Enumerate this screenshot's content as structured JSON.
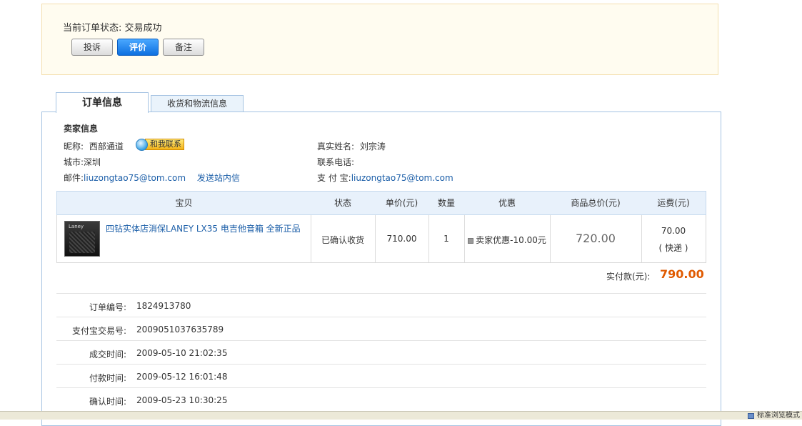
{
  "order_status": {
    "label": "当前订单状态:",
    "value": "交易成功",
    "buttons": {
      "complain": "投诉",
      "rate": "评价",
      "note": "备注"
    }
  },
  "tabs": {
    "order_info": "订单信息",
    "shipping_info": "收货和物流信息"
  },
  "seller": {
    "section_title": "卖家信息",
    "nickname_label": "昵称:",
    "nickname": "西部通道",
    "contact_me": "和我联系",
    "city_label": "城市:",
    "city": "深圳",
    "email_label": "邮件:",
    "email": "liuzongtao75@tom.com",
    "site_message": "发送站内信",
    "realname_label": "真实姓名:",
    "realname": "刘宗涛",
    "phone_label": "联系电话:",
    "phone": "",
    "alipay_label": "支 付 宝:",
    "alipay": "liuzongtao75@tom.com"
  },
  "table": {
    "headers": {
      "item": "宝贝",
      "status": "状态",
      "unit_price": "单价(元)",
      "qty": "数量",
      "discount": "优惠",
      "total": "商品总价(元)",
      "shipping": "运费(元)"
    },
    "row": {
      "title": "四钻实体店消保LANEY LX35 电吉他音箱 全新正品",
      "thumb_brand": "Laney",
      "status": "已确认收货",
      "unit_price": "710.00",
      "qty": "1",
      "discount": "卖家优惠-10.00元",
      "total": "720.00",
      "shipping": "70.00",
      "shipping_method": "( 快递 )"
    }
  },
  "paid": {
    "label": "实付款(元):",
    "amount": "790.00"
  },
  "details": {
    "order_no_label": "订单编号:",
    "order_no": "1824913780",
    "alipay_trade_label": "支付宝交易号:",
    "alipay_trade": "2009051037635789",
    "deal_time_label": "成交时间:",
    "deal_time": "2009-05-10 21:02:35",
    "pay_time_label": "付款时间:",
    "pay_time": "2009-05-12 16:01:48",
    "confirm_time_label": "确认时间:",
    "confirm_time": "2009-05-23 10:30:25"
  },
  "statusbar": {
    "text": "标准浏览模式"
  },
  "colors": {
    "accent_blue": "#0d6fe0",
    "link": "#1b5ea8",
    "price_orange": "#e05a00",
    "status_bg": "#fffcf0"
  }
}
